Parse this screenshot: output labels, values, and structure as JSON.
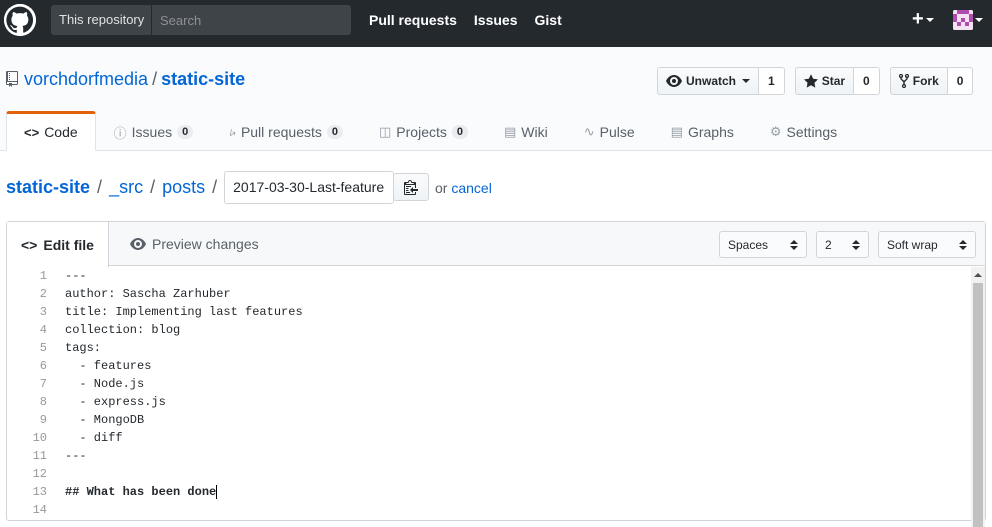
{
  "header": {
    "search_scope": "This repository",
    "search_placeholder": "Search",
    "nav": [
      "Pull requests",
      "Issues",
      "Gist"
    ],
    "plus": "+"
  },
  "repo": {
    "owner": "vorchdorfmedia",
    "separator": "/",
    "name": "static-site",
    "watch_label": "Unwatch",
    "watch_count": "1",
    "star_label": "Star",
    "star_count": "0",
    "fork_label": "Fork",
    "fork_count": "0"
  },
  "tabs": [
    {
      "label": "Code",
      "icon": "code-icon"
    },
    {
      "label": "Issues",
      "icon": "issue-icon",
      "count": "0"
    },
    {
      "label": "Pull requests",
      "icon": "pull-request-icon",
      "count": "0"
    },
    {
      "label": "Projects",
      "icon": "project-icon",
      "count": "0"
    },
    {
      "label": "Wiki",
      "icon": "book-icon"
    },
    {
      "label": "Pulse",
      "icon": "pulse-icon"
    },
    {
      "label": "Graphs",
      "icon": "graph-icon"
    },
    {
      "label": "Settings",
      "icon": "gear-icon"
    }
  ],
  "breadcrumb": {
    "root": "static-site",
    "parts": [
      "_src",
      "posts"
    ],
    "slash": "/",
    "filename": "2017-03-30-Last-feature",
    "or_text": "or",
    "cancel": "cancel"
  },
  "editor": {
    "edit_tab": "Edit file",
    "preview_tab": "Preview changes",
    "indent_mode": "Spaces",
    "indent_size": "2",
    "wrap_mode": "Soft wrap",
    "lines": [
      "---",
      "author: Sascha Zarhuber",
      "title: Implementing last features",
      "collection: blog",
      "tags:",
      "  - features",
      "  - Node.js",
      "  - express.js",
      "  - MongoDB",
      "  - diff",
      "---",
      "",
      "## What has been done",
      ""
    ],
    "line_numbers": [
      "1",
      "2",
      "3",
      "4",
      "5",
      "6",
      "7",
      "8",
      "9",
      "10",
      "11",
      "12",
      "13",
      "14"
    ]
  }
}
